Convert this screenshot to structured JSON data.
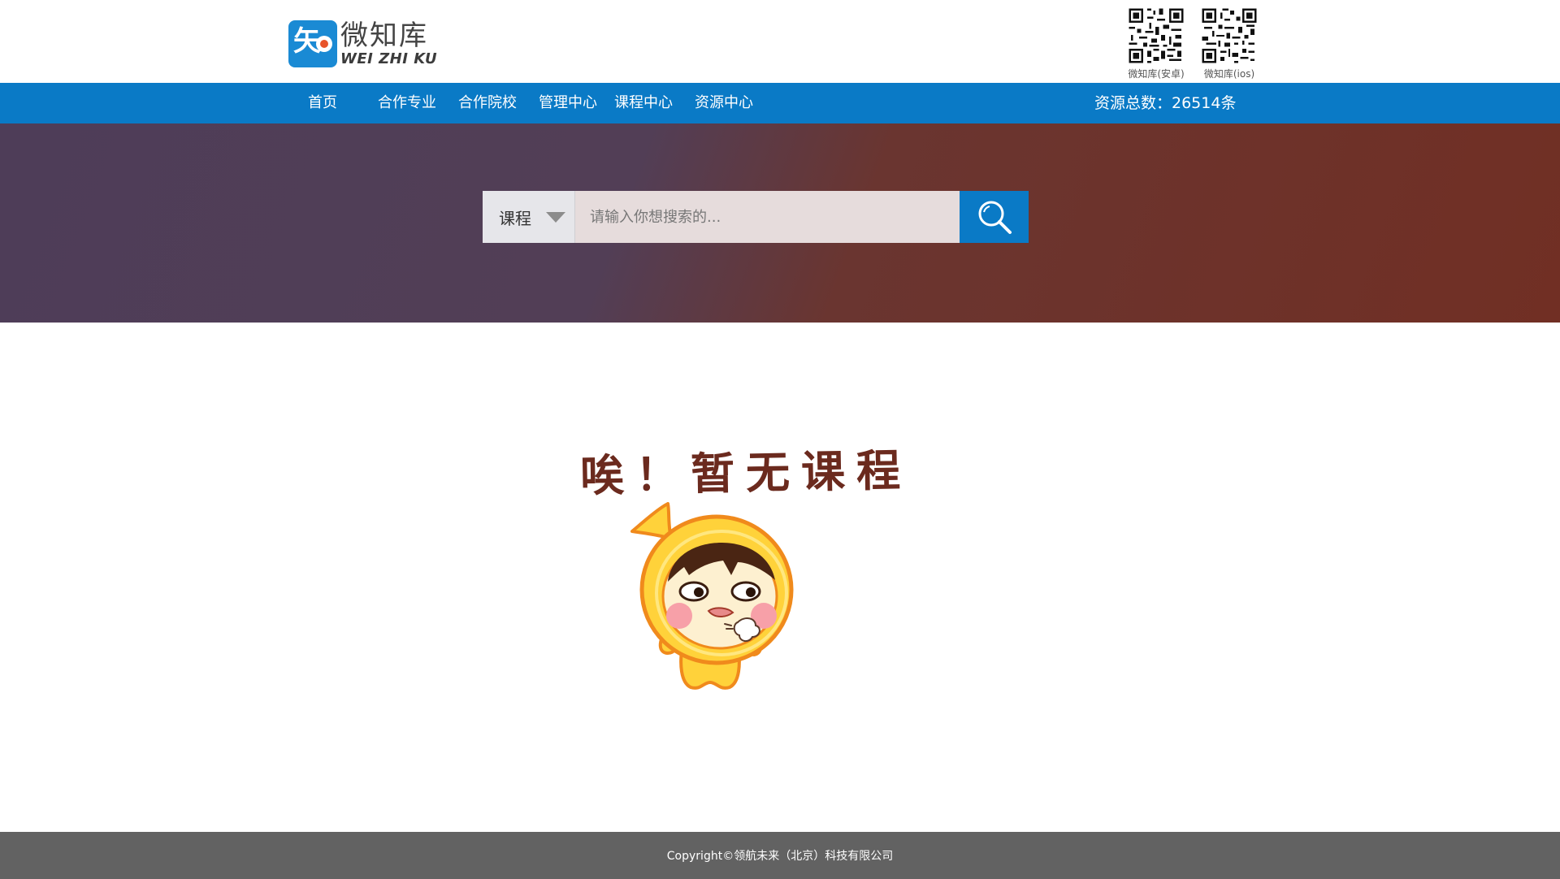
{
  "header": {
    "logo_cn": "微知库",
    "logo_en": "WEI ZHI KU",
    "qr_codes": [
      {
        "label": "微知库(安卓)",
        "icon": "qr-code-icon"
      },
      {
        "label": "微知库(ios)",
        "icon": "qr-code-icon"
      }
    ]
  },
  "nav": {
    "items": [
      "首页",
      "合作专业",
      "合作院校",
      "管理中心",
      "课程中心",
      "资源中心"
    ],
    "stat": "资源总数：26514条"
  },
  "search": {
    "type_selected": "课程",
    "placeholder": "请输入你想搜索的...",
    "value": "",
    "button_icon": "search-icon"
  },
  "empty_state": {
    "message": "唉！暂无课程",
    "illustration": "crying-mascot-illustration"
  },
  "footer": {
    "copyright": "Copyright©领航未来（北京）科技有限公司"
  },
  "colors": {
    "nav_blue": "#0a7ac6",
    "hero_left": "#4e3d58",
    "hero_right": "#712f24",
    "footer": "#626262",
    "empty_text": "#6b2a1e"
  }
}
